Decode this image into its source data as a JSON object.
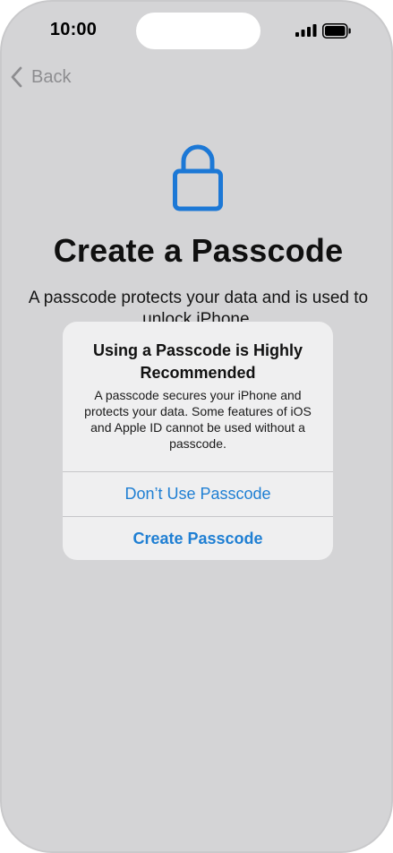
{
  "status_bar": {
    "time": "10:00",
    "signal_icon": "cellular-signal-icon",
    "battery_icon": "battery-icon"
  },
  "nav": {
    "back_label": "Back",
    "back_icon": "chevron-left-icon"
  },
  "main": {
    "icon": "lock-icon",
    "title": "Create a Passcode",
    "description": "A passcode protects your data and is used to unlock iPhone."
  },
  "alert": {
    "title": "Using a Passcode is Highly Recommended",
    "message": "A passcode secures your iPhone and protects your data. Some features of iOS and Apple ID cannot be used without a passcode.",
    "buttons": [
      {
        "label": "Don’t Use Passcode"
      },
      {
        "label": "Create Passcode"
      }
    ]
  },
  "colors": {
    "background": "#d4d4d6",
    "accent": "#1f7fd3",
    "lock_icon": "#1c78d6",
    "alert_background": "#efeff0"
  }
}
